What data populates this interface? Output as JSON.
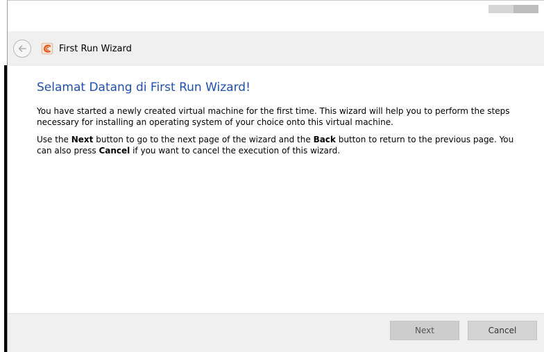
{
  "header": {
    "title": "First Run Wizard",
    "back_icon": "back-arrow-icon",
    "app_icon": "virtualbox-logo-icon"
  },
  "content": {
    "heading": "Selamat Datang di First Run Wizard!",
    "paragraph1": "You have started a newly created virtual machine for the first time. This wizard will help you to perform the steps necessary for installing an operating system of your choice onto this virtual machine.",
    "paragraph2_part1": "Use the ",
    "paragraph2_bold1": "Next",
    "paragraph2_part2": " button to go to the next page of the wizard and the ",
    "paragraph2_bold2": "Back",
    "paragraph2_part3": " button to return to the previous page. You can also press ",
    "paragraph2_bold3": "Cancel",
    "paragraph2_part4": " if you want to cancel the execution of this wizard."
  },
  "footer": {
    "next_label": "Next",
    "cancel_label": "Cancel"
  },
  "colors": {
    "heading": "#1e50b4",
    "header_bg": "#f0f0f0",
    "footer_bg": "#f0f0f0",
    "button_bg": "#cccccc"
  }
}
